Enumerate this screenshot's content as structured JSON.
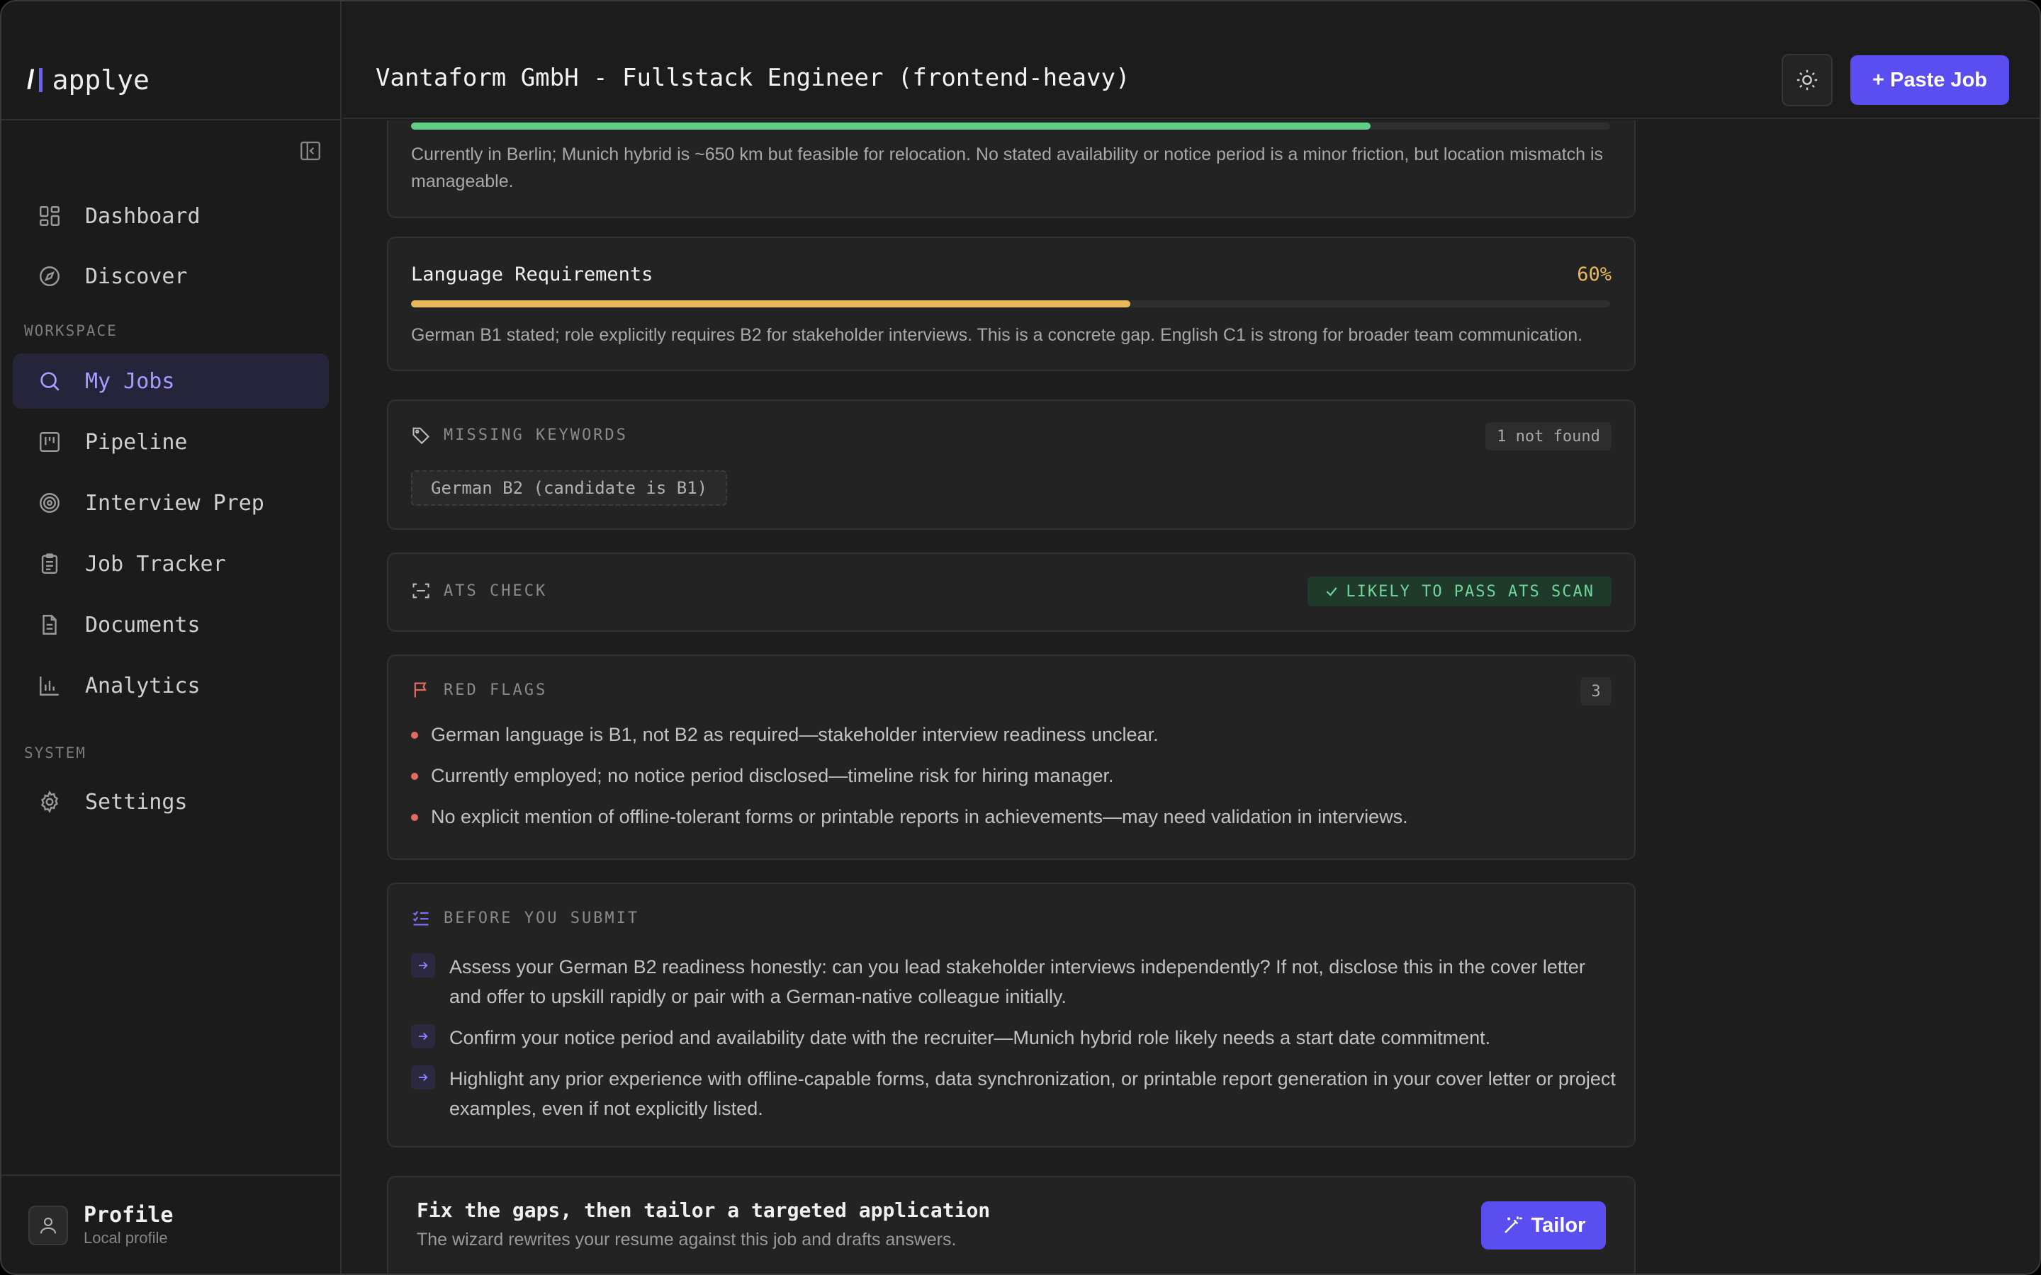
{
  "app": {
    "name": "applye"
  },
  "header": {
    "title": "Vantaform GmbH - Fullstack Engineer (frontend-heavy)",
    "paste_label": "+ Paste Job"
  },
  "sidebar": {
    "items": [
      {
        "label": "Dashboard",
        "icon": "dashboard-icon"
      },
      {
        "label": "Discover",
        "icon": "compass-icon"
      },
      {
        "label": "My Jobs",
        "icon": "search-icon",
        "active": true
      },
      {
        "label": "Pipeline",
        "icon": "kanban-icon"
      },
      {
        "label": "Interview Prep",
        "icon": "target-icon"
      },
      {
        "label": "Job Tracker",
        "icon": "clipboard-icon"
      },
      {
        "label": "Documents",
        "icon": "document-icon"
      },
      {
        "label": "Analytics",
        "icon": "bar-chart-icon"
      },
      {
        "label": "Settings",
        "icon": "gear-icon"
      }
    ],
    "section_workspace": "WORKSPACE",
    "section_system": "SYSTEM",
    "profile": {
      "name": "Profile",
      "sub": "Local profile"
    }
  },
  "location_card": {
    "progress": 0.8,
    "color": "#5fd083",
    "description": "Currently in Berlin; Munich hybrid is ~650 km but feasible for relocation. No stated availability or notice period is a minor friction, but location mismatch is manageable."
  },
  "language_card": {
    "title": "Language Requirements",
    "percent": "60%",
    "progress": 0.6,
    "color": "#e8b95a",
    "description": "German B1 stated; role explicitly requires B2 for stakeholder interviews. This is a concrete gap. English C1 is strong for broader team communication."
  },
  "missing_keywords": {
    "label": "MISSING KEYWORDS",
    "count_label": "1 not found",
    "keywords": [
      "German B2 (candidate is B1)"
    ]
  },
  "ats": {
    "label": "ATS CHECK",
    "status": "LIKELY TO PASS ATS SCAN"
  },
  "red_flags": {
    "label": "RED FLAGS",
    "count": "3",
    "items": [
      "German language is B1, not B2 as required—stakeholder interview readiness unclear.",
      "Currently employed; no notice period disclosed—timeline risk for hiring manager.",
      "No explicit mention of offline-tolerant forms or printable reports in achievements—may need validation in interviews."
    ]
  },
  "before_submit": {
    "label": "BEFORE YOU SUBMIT",
    "items": [
      "Assess your German B2 readiness honestly: can you lead stakeholder interviews independently? If not, disclose this in the cover letter and offer to upskill rapidly or pair with a German-native colleague initially.",
      "Confirm your notice period and availability date with the recruiter—Munich hybrid role likely needs a start date commitment.",
      "Highlight any prior experience with offline-capable forms, data synchronization, or printable report generation in your cover letter or project examples, even if not explicitly listed."
    ]
  },
  "cta": {
    "title": "Fix the gaps, then tailor a targeted application",
    "subtitle": "The wizard rewrites your resume against this job and drafts answers.",
    "button": "Tailor"
  },
  "colors": {
    "accent": "#5b4ef0",
    "danger": "#e46a62",
    "success": "#6fd69a"
  }
}
